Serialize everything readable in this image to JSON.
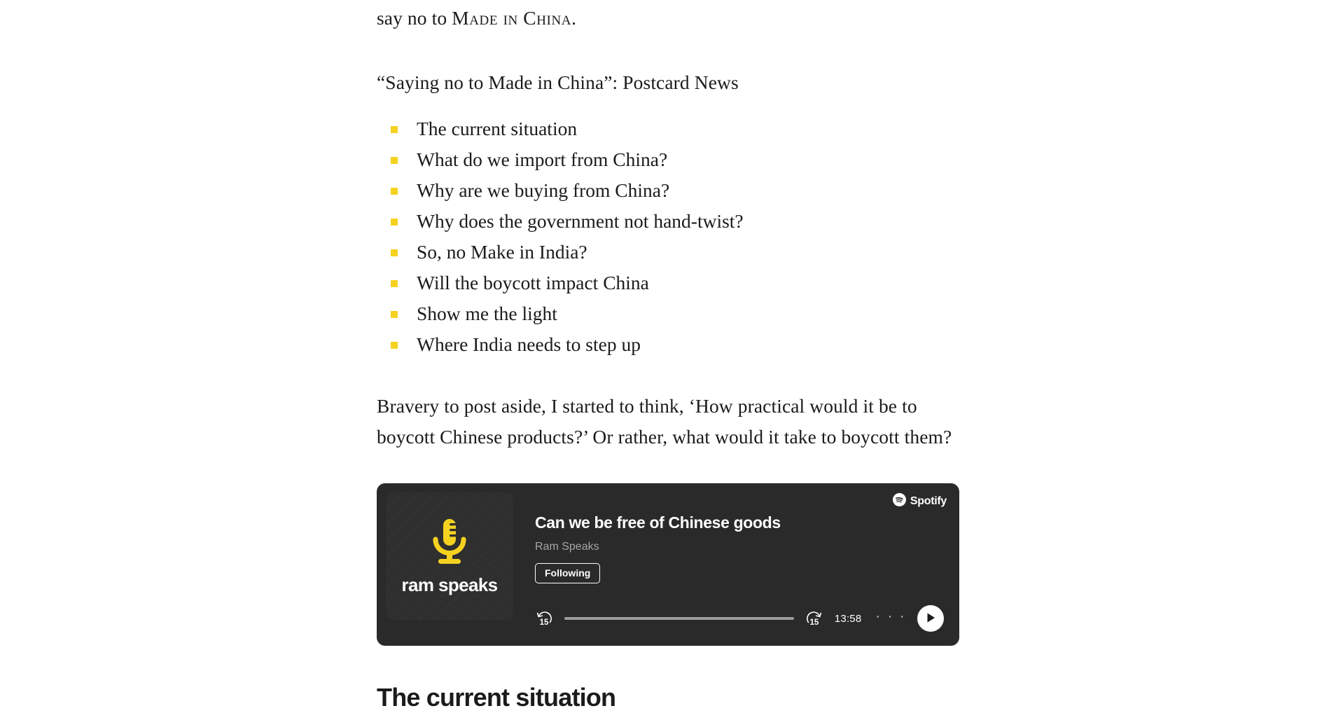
{
  "article": {
    "paragraph_top": {
      "lead": "say no to ",
      "smallcaps": "Made in China",
      "tail": "."
    },
    "caption": "“Saying no to Made in China”: Postcard News",
    "toc_items": [
      {
        "label": "The current situation"
      },
      {
        "label": "What do we import from China?"
      },
      {
        "label": "Why are we buying from China?"
      },
      {
        "label": "Why does the government not hand-twist?"
      },
      {
        "label": "So, no Make in India?"
      },
      {
        "label": "Will the boycott impact China"
      },
      {
        "label": "Show me the light"
      },
      {
        "label": "Where India needs to step up"
      }
    ],
    "paragraph_body": "Bravery to post aside, I started to think, ‘How practical would it be to boycott Chinese products?’ Or rather, what would it take to boycott them?",
    "section_heading": "The current situation"
  },
  "spotify_embed": {
    "brand_label": "Spotify",
    "brand_icon": "spotify-logo-icon",
    "cover": {
      "title": "ram speaks",
      "icon": "microphone-icon",
      "accent_color": "#f5d220"
    },
    "track_title": "Can we be free of Chinese goods",
    "show_name": "Ram Speaks",
    "follow_label": "Following",
    "controls": {
      "rewind_label": "15",
      "rewind_icon": "rewind-15-icon",
      "forward_label": "15",
      "forward_icon": "forward-15-icon",
      "duration": "13:58",
      "more_label": "· · ·",
      "more_icon": "more-options-icon",
      "play_icon": "play-icon",
      "progress_percent": 0
    },
    "colors": {
      "card_background": "#2a2a2a",
      "cover_background": "#2f2f2f",
      "text_primary": "#ffffff",
      "text_secondary": "#a6a6a6",
      "progress_track": "#9b9b9b"
    }
  },
  "theme": {
    "bullet_color": "#f5d220",
    "text_color": "#1c1b1a",
    "page_background": "#ffffff"
  }
}
